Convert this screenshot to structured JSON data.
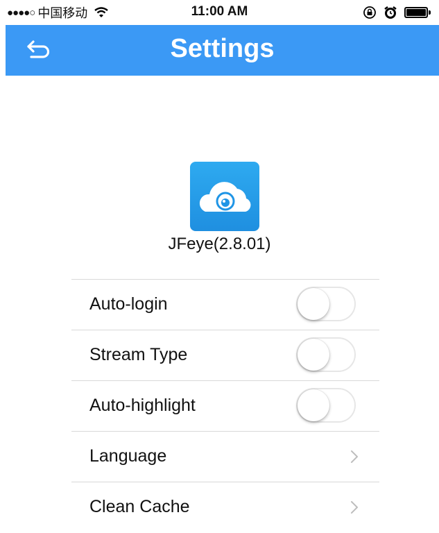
{
  "status_bar": {
    "signal": "●●●●○",
    "carrier": "中国移动",
    "time": "11:00 AM"
  },
  "header": {
    "title": "Settings"
  },
  "app": {
    "version_label": "JFeye(2.8.01)"
  },
  "settings": [
    {
      "label": "Auto-login",
      "control": "toggle",
      "on": false
    },
    {
      "label": "Stream Type",
      "control": "toggle",
      "on": false
    },
    {
      "label": "Auto-highlight",
      "control": "toggle",
      "on": false
    },
    {
      "label": "Language",
      "control": "chevron"
    },
    {
      "label": "Clean Cache",
      "control": "chevron"
    }
  ],
  "colors": {
    "header": "#3b99f5",
    "app_icon": "#1f95e6"
  }
}
